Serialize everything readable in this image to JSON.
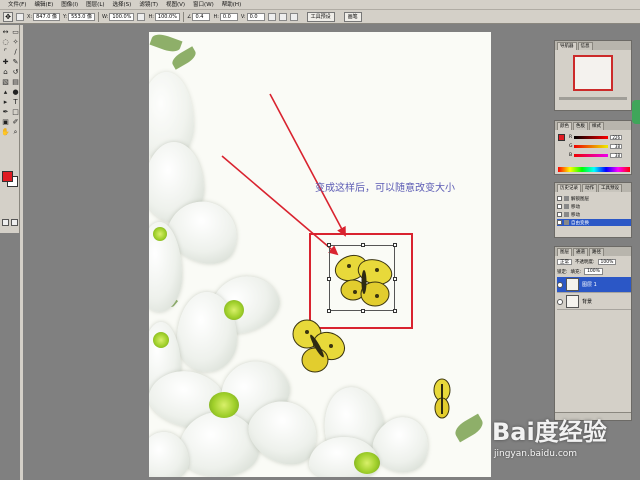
{
  "menu": [
    "文件(F)",
    "编辑(E)",
    "图像(I)",
    "图层(L)",
    "选择(S)",
    "滤镜(T)",
    "视图(V)",
    "窗口(W)",
    "帮助(H)"
  ],
  "options": {
    "x_label": "X:",
    "x_value": "847.0 像",
    "y_label": "Y:",
    "y_value": "553.0 像",
    "w_label": "W:",
    "w_value": "100.0%",
    "h_label": "H:",
    "h_value": "100.0%",
    "angle_value": "0.4",
    "h_skew_label": "H:",
    "h_skew_value": "0.0",
    "v_skew_label": "V:",
    "v_skew_value": "0.0",
    "palette_tab_1": "工具预设",
    "palette_tab_2": "画笔"
  },
  "annotation": {
    "text": "变成这样后，可以随意改变大小",
    "text_color": "#5a5ab4",
    "box_color": "#d9232f"
  },
  "panels": {
    "navigator": {
      "tab1": "导航器",
      "tab2": "信息"
    },
    "color": {
      "tab1": "颜色",
      "tab2": "色板",
      "tab3": "样式",
      "rows": [
        {
          "label": "R",
          "value": "226"
        },
        {
          "label": "G",
          "value": "38"
        },
        {
          "label": "B",
          "value": "38"
        }
      ]
    },
    "history": {
      "tab1": "历史记录",
      "tab2": "动作",
      "tab3": "工具预设",
      "items": [
        "解锁图层",
        "移动",
        "移动",
        "自由变换"
      ]
    },
    "layers": {
      "tab1": "图层",
      "tab2": "通道",
      "tab3": "路径",
      "blend_mode": "正常",
      "opacity_label": "不透明度:",
      "opacity_value": "100%",
      "lock_label": "锁定:",
      "fill_label": "填充:",
      "fill_value": "100%",
      "items": [
        "图层 1",
        "背景"
      ]
    }
  },
  "watermark": {
    "logo": "Bai度经验",
    "url": "jingyan.baidu.com"
  },
  "colors": {
    "foreground": "#e01b22",
    "background": "#ffffff",
    "selection": "#2b57c6"
  }
}
